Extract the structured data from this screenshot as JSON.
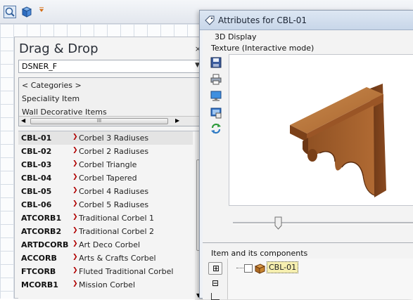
{
  "toolbar": {
    "icons": [
      "zoom-icon",
      "cube-icon",
      "dropdown-arrow-icon"
    ]
  },
  "drag_drop": {
    "title": "Drag & Drop",
    "close_glyph": "×",
    "combo_value": "DSNER_F",
    "categories": [
      "< Categories >",
      "Speciality Item",
      "Wall Decorative Items"
    ],
    "scroll_glyph": "III",
    "items": [
      {
        "code": "CBL-01",
        "name": "Corbel 3 Radiuses"
      },
      {
        "code": "CBL-02",
        "name": "Corbel 2 Radiuses"
      },
      {
        "code": "CBL-03",
        "name": "Corbel Triangle"
      },
      {
        "code": "CBL-04",
        "name": "Corbel Tapered"
      },
      {
        "code": "CBL-05",
        "name": "Corbel 4 Radiuses"
      },
      {
        "code": "CBL-06",
        "name": "Corbel 5 Radiuses"
      },
      {
        "code": "ATCORB1",
        "name": "Traditional Corbel 1"
      },
      {
        "code": "ATCORB2",
        "name": "Traditional Corbel 2"
      },
      {
        "code": "ARTDCORB",
        "name": "Art Deco Corbel"
      },
      {
        "code": "ACCORB",
        "name": "Arts & Crafts Corbel"
      },
      {
        "code": "FTCORB",
        "name": "Fluted Traditional Corbel"
      },
      {
        "code": "MCORB1",
        "name": "Mission  Corbel"
      }
    ],
    "selected_index": 0
  },
  "attributes": {
    "title": "Attributes for CBL-01",
    "display_label": "3D Display",
    "texture_label": "Texture (Interactive mode)",
    "tools": [
      "save-icon",
      "print-icon",
      "monitor-icon",
      "snapshot-icon",
      "refresh-icon"
    ],
    "slider_value": 0.25,
    "components_label": "Item and its components",
    "tree_node": "CBL-01"
  },
  "colors": {
    "wood_light": "#b8763e",
    "wood_mid": "#9a5a2a",
    "wood_dark": "#6e3a18",
    "selection": "#f6efb0"
  }
}
